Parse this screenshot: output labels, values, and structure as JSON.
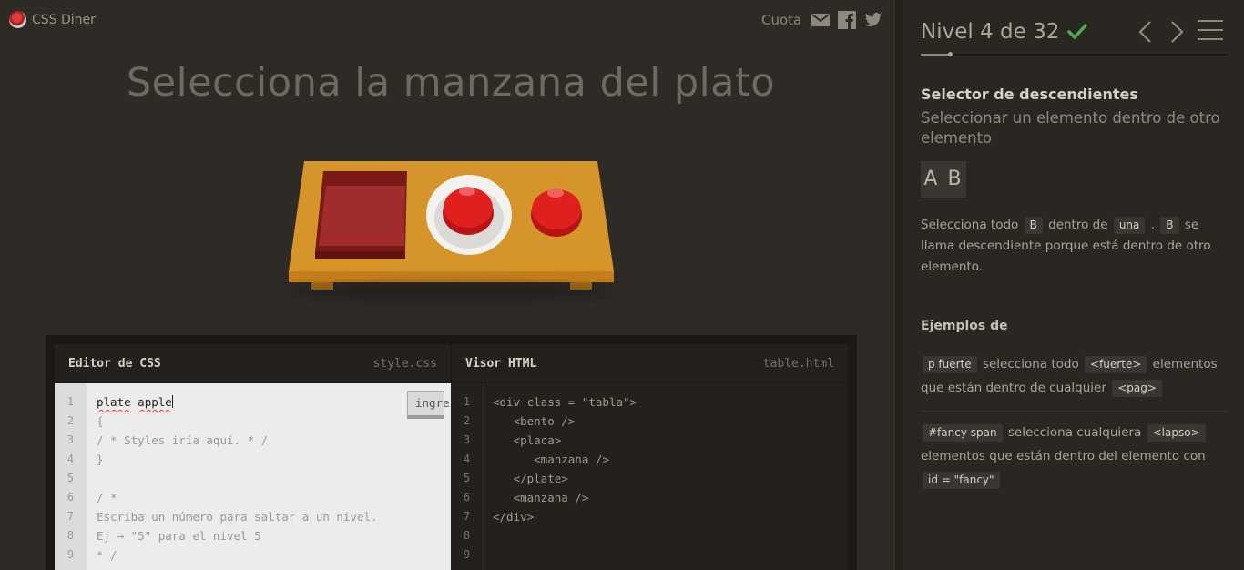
{
  "header": {
    "logo_text": "CSS Diner",
    "share_label": "Cuota",
    "share_icons": [
      "mail-icon",
      "facebook-icon",
      "twitter-icon"
    ]
  },
  "instruction": "Selecciona la manzana del plato",
  "scene_items": [
    "bento",
    "plate-with-apple",
    "apple"
  ],
  "editor": {
    "css_title": "Editor de CSS",
    "css_file": "style.css",
    "html_title": "Visor HTML",
    "html_file": "table.html",
    "enter_button": "ingresar",
    "css_line_numbers": [
      "1",
      "2",
      "3",
      "4",
      "5",
      "6",
      "7",
      "8",
      "9"
    ],
    "css_input_words": [
      "plate",
      "apple"
    ],
    "css_lines": [
      "{",
      "/ * Styles iría aquí. * /",
      "}",
      "",
      "/ *",
      "Escriba un número para saltar a un nivel.",
      "Ej → \"5\" para el nivel 5",
      "* /"
    ],
    "html_line_numbers": [
      "1",
      "2",
      "3",
      "4",
      "5",
      "6",
      "7",
      "8",
      "9"
    ],
    "html_lines": [
      "<div class = \"tabla\">",
      "   <bento />",
      "   <placa>",
      "      <manzana />",
      "   </plate>",
      "   <manzana />",
      "</div>",
      "",
      ""
    ]
  },
  "sidebar": {
    "level_text": "Nivel 4 de 32",
    "level_current": 4,
    "level_total": 32,
    "completed": true,
    "selector_name": "Selector de descendientes",
    "selector_desc": "Seleccionar un elemento dentro de otro elemento",
    "syntax": "A B",
    "help": {
      "p1": "Selecciona todo",
      "tag1": "B",
      "p2": "dentro de",
      "tag2": "una",
      "p3": ".",
      "tag3": "B",
      "p4": "se llama descendiente porque está dentro de otro elemento."
    },
    "examples_title": "Ejemplos de",
    "example1": {
      "code": "p fuerte",
      "t1": "selecciona todo",
      "tag1": "<fuerte>",
      "t2": "elementos que están dentro de cualquier",
      "tag2": "<pag>"
    },
    "example2": {
      "code": "#fancy span",
      "t1": "selecciona cualquiera",
      "tag1": "<lapso>",
      "t2": "elementos que están dentro del elemento con",
      "tag2": "id = \"fancy\""
    }
  },
  "colors": {
    "background": "#2e2a26",
    "sidebar": "#2a2622",
    "check": "#4cae4c",
    "apple": "#e01f1f",
    "table": "#d6952b",
    "bento": "#8a1f1f"
  }
}
